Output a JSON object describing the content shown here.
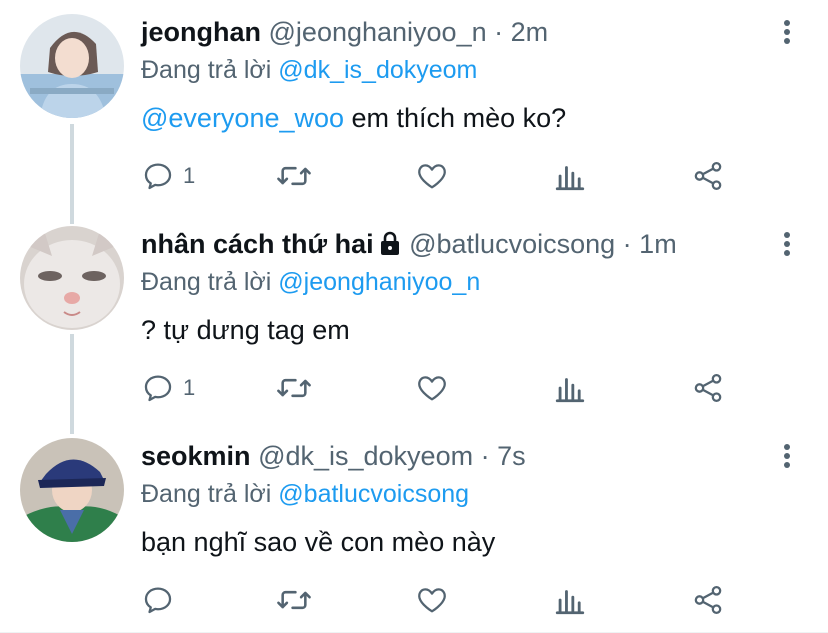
{
  "replying_label": "Đang trả lời",
  "colors": {
    "link": "#1d9bf0",
    "secondary": "#536471",
    "text": "#0f1419",
    "thread_line": "#cfd9de"
  },
  "tweets": [
    {
      "name": "jeonghan",
      "handle": "@jeonghaniyoo_n",
      "dot": "·",
      "time": "2m",
      "locked": false,
      "replying_to": "@dk_is_dokyeom",
      "body_mention": "@everyone_woo",
      "body_text": " em thích mèo ko?",
      "reply_count": "1",
      "avatar": "avatar-jeonghan"
    },
    {
      "name": "nhân cách thứ hai",
      "handle": "@batlucvoicsong",
      "dot": "·",
      "time": "1m",
      "locked": true,
      "replying_to": "@jeonghaniyoo_n",
      "body_mention": "",
      "body_text": "? tự dưng tag em",
      "reply_count": "1",
      "avatar": "avatar-cat"
    },
    {
      "name": "seokmin",
      "handle": "@dk_is_dokyeom",
      "dot": "·",
      "time": "7s",
      "locked": false,
      "replying_to": "@batlucvoicsong",
      "body_mention": "",
      "body_text": "bạn nghĩ sao về con mèo này",
      "reply_count": "",
      "avatar": "avatar-seokmin"
    }
  ],
  "icons": [
    "reply-icon",
    "retweet-icon",
    "like-icon",
    "analytics-icon",
    "share-icon",
    "more-icon",
    "lock-icon"
  ]
}
